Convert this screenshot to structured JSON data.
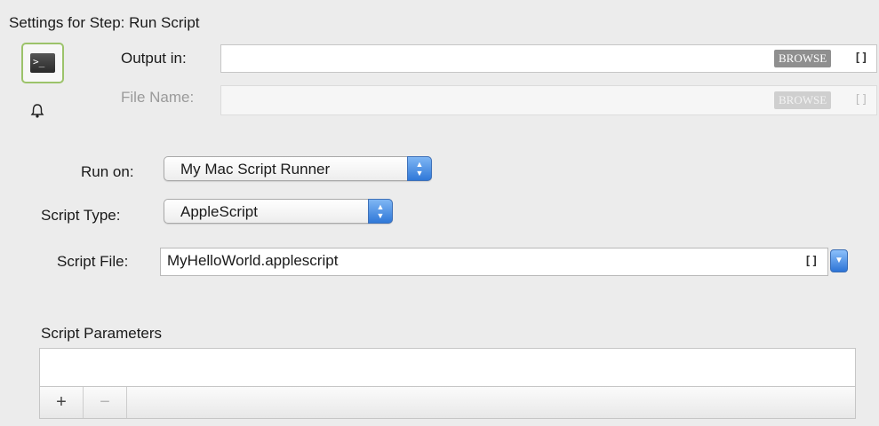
{
  "header": {
    "title": "Settings for Step: Run Script"
  },
  "icons": {
    "step_icon": "terminal-icon",
    "notify_icon": "bell-icon",
    "step_icon_glyph": ">_"
  },
  "output": {
    "output_in_label": "Output in:",
    "output_in_value": "",
    "file_name_label": "File Name:",
    "file_name_value": "",
    "browse_label": "BROWSE",
    "bracket": "[]"
  },
  "run_on": {
    "label": "Run on:",
    "selected": "My Mac Script Runner"
  },
  "script_type": {
    "label": "Script Type:",
    "selected": "AppleScript"
  },
  "script_file": {
    "label": "Script File:",
    "value": "MyHelloWorld.applescript",
    "bracket": "[]"
  },
  "params": {
    "title": "Script Parameters",
    "add_label": "+",
    "remove_label": "−"
  },
  "colors": {
    "accent": "#2f78d8",
    "icon_border": "#9cc36a",
    "background": "#ececec"
  }
}
